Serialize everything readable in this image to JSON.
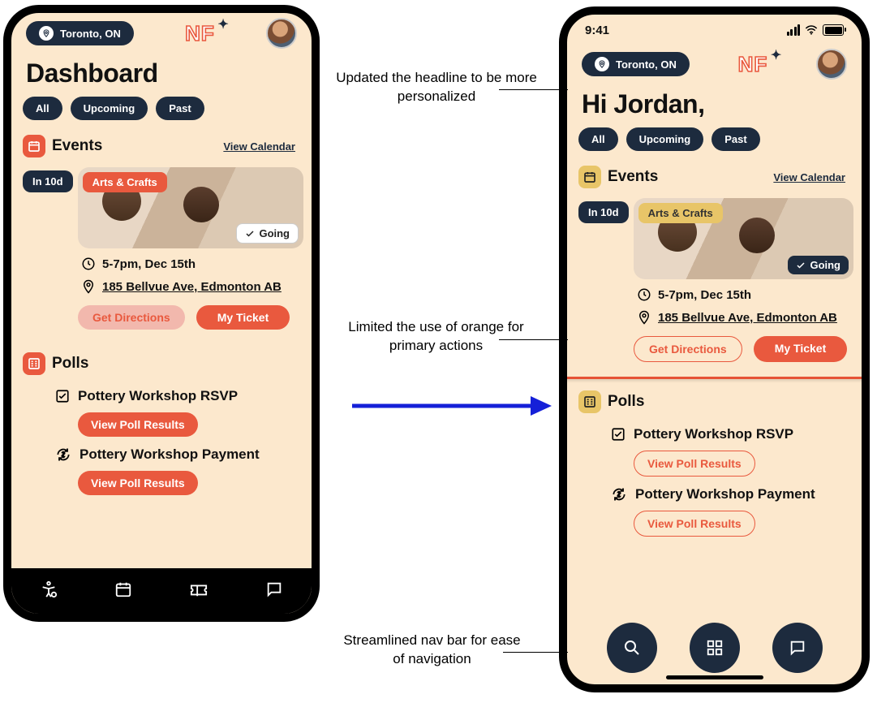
{
  "status": {
    "time": "9:41"
  },
  "header": {
    "location": "Toronto, ON",
    "logo": "NF"
  },
  "left": {
    "headline": "Dashboard",
    "filters": [
      "All",
      "Upcoming",
      "Past"
    ],
    "events": {
      "title": "Events",
      "link": "View Calendar"
    },
    "event": {
      "in": "In 10d",
      "tag": "Arts & Crafts",
      "going": "Going",
      "time": "5-7pm, Dec 15th",
      "addr": "185 Bellvue Ave, Edmonton AB",
      "directions": "Get Directions",
      "ticket": "My Ticket"
    },
    "polls": {
      "title": "Polls"
    },
    "poll1": {
      "title": "Pottery Workshop RSVP",
      "btn": "View Poll Results"
    },
    "poll2": {
      "title": "Pottery Workshop Payment",
      "btn": "View Poll Results"
    }
  },
  "right": {
    "headline": "Hi Jordan,",
    "filters": [
      "All",
      "Upcoming",
      "Past"
    ],
    "events": {
      "title": "Events",
      "link": "View Calendar"
    },
    "event": {
      "in": "In 10d",
      "tag": "Arts & Crafts",
      "going": "Going",
      "time": "5-7pm, Dec 15th",
      "addr": "185 Bellvue Ave, Edmonton AB",
      "directions": "Get Directions",
      "ticket": "My Ticket"
    },
    "polls": {
      "title": "Polls"
    },
    "poll1": {
      "title": "Pottery Workshop RSVP",
      "btn": "View Poll Results"
    },
    "poll2": {
      "title": "Pottery Workshop Payment",
      "btn": "View Poll Results"
    }
  },
  "anno": {
    "a1": "Updated the headline to be more personalized",
    "a2": "Limited the use of orange for primary actions",
    "a3": "Streamlined nav bar for ease of navigation"
  }
}
